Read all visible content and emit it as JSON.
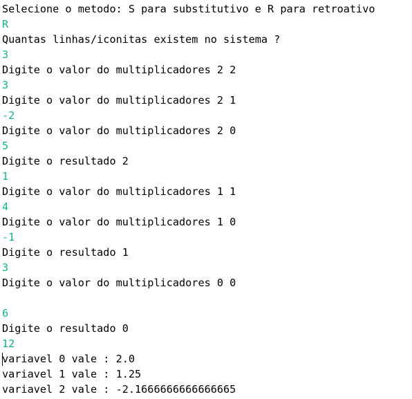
{
  "colors": {
    "prompt_text": "#000000",
    "user_input": "#0fb58a",
    "background": "#ffffff"
  },
  "console": {
    "lines": [
      {
        "kind": "prompt",
        "text": "Selecione o metodo: S para substitutivo e R para retroativo"
      },
      {
        "kind": "input",
        "text": "R"
      },
      {
        "kind": "prompt",
        "text": "Quantas linhas/iconitas existem no sistema ?"
      },
      {
        "kind": "input",
        "text": "3"
      },
      {
        "kind": "prompt",
        "text": "Digite o valor do multiplicadores 2 2"
      },
      {
        "kind": "input",
        "text": "3"
      },
      {
        "kind": "prompt",
        "text": "Digite o valor do multiplicadores 2 1"
      },
      {
        "kind": "input",
        "text": "-2"
      },
      {
        "kind": "prompt",
        "text": "Digite o valor do multiplicadores 2 0"
      },
      {
        "kind": "input",
        "text": "5"
      },
      {
        "kind": "prompt",
        "text": "Digite o resultado 2"
      },
      {
        "kind": "input",
        "text": "1"
      },
      {
        "kind": "prompt",
        "text": "Digite o valor do multiplicadores 1 1"
      },
      {
        "kind": "input",
        "text": "4"
      },
      {
        "kind": "prompt",
        "text": "Digite o valor do multiplicadores 1 0"
      },
      {
        "kind": "input",
        "text": "-1"
      },
      {
        "kind": "prompt",
        "text": "Digite o resultado 1"
      },
      {
        "kind": "input",
        "text": "3"
      },
      {
        "kind": "prompt",
        "text": "Digite o valor do multiplicadores 0 0"
      },
      {
        "kind": "blank",
        "text": ""
      },
      {
        "kind": "input",
        "text": "6"
      },
      {
        "kind": "prompt",
        "text": "Digite o resultado 0"
      },
      {
        "kind": "input",
        "text": "12"
      },
      {
        "kind": "prompt",
        "text": "variavel 0 vale : 2.0"
      },
      {
        "kind": "prompt",
        "text": "variavel 1 vale : 1.25"
      },
      {
        "kind": "prompt",
        "text": "variavel 2 vale : -2.1666666666666665"
      }
    ]
  }
}
